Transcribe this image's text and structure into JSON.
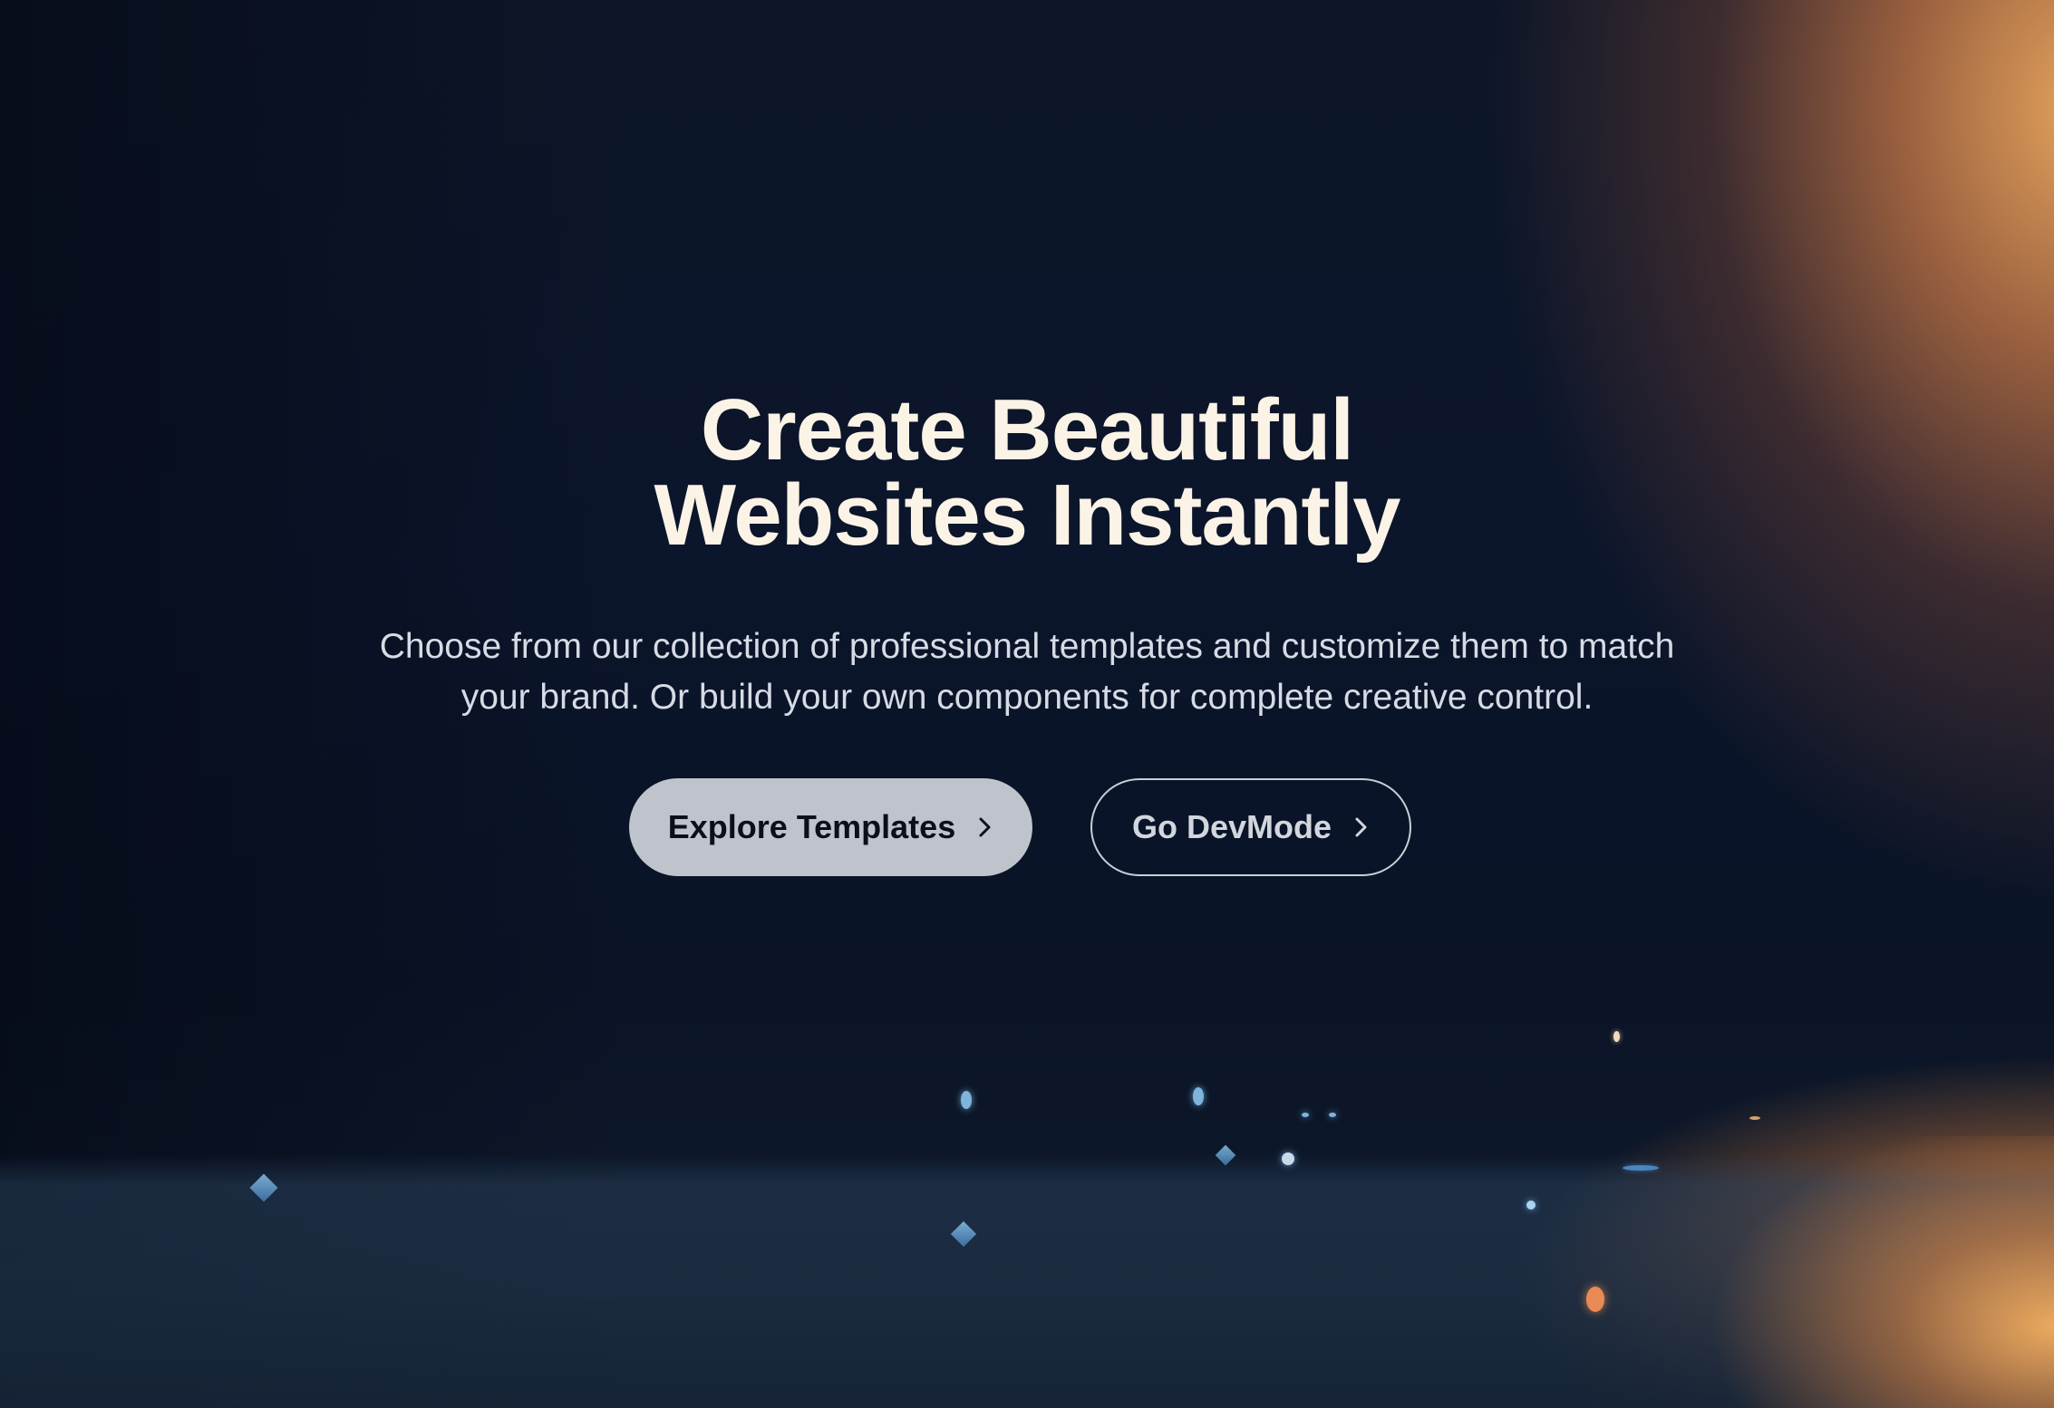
{
  "hero": {
    "headline_line1": "Create Beautiful",
    "headline_line2": "Websites Instantly",
    "subtext_line1": "Choose from our collection of professional templates and customize them to match",
    "subtext_line2": "your brand. Or build your own components for complete creative control.",
    "primary_button": {
      "label": "Explore Templates",
      "icon": "chevron-right-icon"
    },
    "secondary_button": {
      "label": "Go DevMode",
      "icon": "chevron-right-icon"
    }
  },
  "colors": {
    "background": "#0b152b",
    "accent_glow": "#f0aa5f",
    "headline": "#fbf3e6",
    "primary_button_bg": "#bfc4cc",
    "secondary_button_border": "#c9ced6"
  }
}
